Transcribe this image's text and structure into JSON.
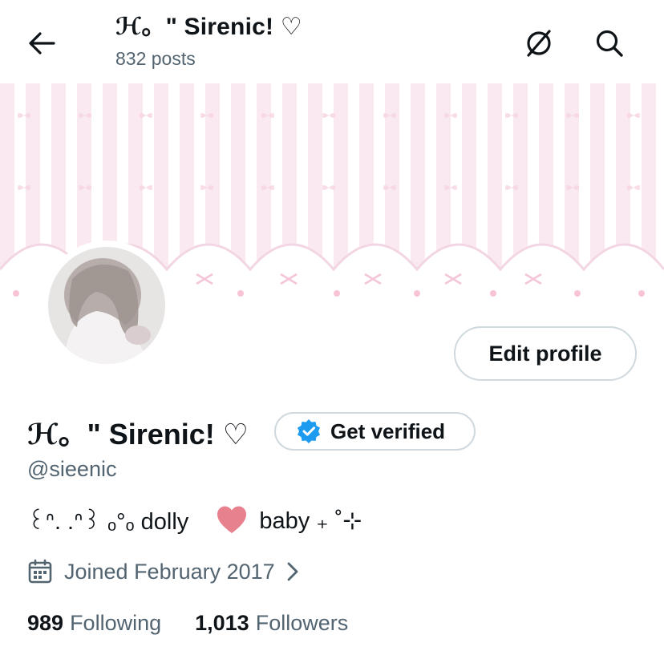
{
  "header": {
    "title": "ℋ。\" Sirenic! ♡",
    "posts": "832 posts"
  },
  "profile": {
    "display_name": "ℋ。\" Sirenic! ♡",
    "handle": "@sieenic",
    "edit_label": "Edit profile",
    "verify_label": "Get verified",
    "bio": {
      "part1": "꒰ᐢ. .ᐢ꒱ ₒ°ₒ  dolly",
      "part2": "baby ₊ ˚⊹"
    },
    "joined": "Joined February 2017",
    "following_count": "989",
    "following_label": "Following",
    "followers_count": "1,013",
    "followers_label": "Followers"
  },
  "colors": {
    "verified_badge": "#1d9bf0",
    "heart": "#e8818e",
    "banner_pink": "#fbe9f1",
    "secondary_text": "#536471"
  },
  "icons": {
    "back": "arrow-left-icon",
    "translate": "translate-icon",
    "search": "search-icon",
    "verified": "verified-badge-icon",
    "heart": "heart-icon",
    "calendar": "calendar-icon",
    "chevron": "chevron-right-icon"
  }
}
